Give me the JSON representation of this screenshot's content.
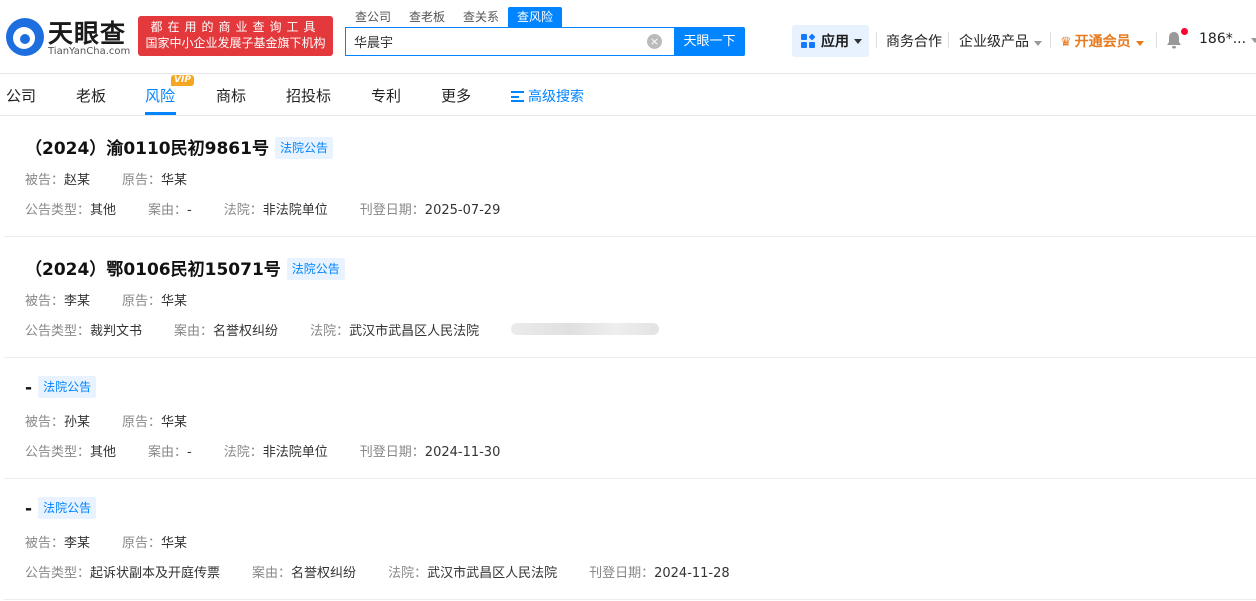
{
  "header": {
    "logo_cn": "天眼查",
    "logo_en": "TianYanCha.com",
    "slogan_line1": "都在用的商业查询工具",
    "slogan_line2": "国家中小企业发展子基金旗下机构",
    "search_tabs": [
      "查公司",
      "查老板",
      "查关系",
      "查风险"
    ],
    "active_search_tab": "查风险",
    "search_value": "华晨宇",
    "search_button": "天眼一下",
    "apps_label": "应用",
    "business_coop": "商务合作",
    "enterprise_products": "企业级产品",
    "vip_link": "开通会员",
    "user_phone": "186*..."
  },
  "subnav": {
    "items": [
      "公司",
      "老板",
      "风险",
      "商标",
      "招投标",
      "专利",
      "更多"
    ],
    "active": "风险",
    "vip_badge": "VIP",
    "advanced_search": "高级搜索"
  },
  "labels": {
    "defendant": "被告：",
    "plaintiff": "原告：",
    "notice_type": "公告类型：",
    "cause": "案由：",
    "court": "法院：",
    "publish_date": "刊登日期："
  },
  "records": [
    {
      "title": "（2024）渝0110民初9861号",
      "tag": "法院公告",
      "defendant": "赵某",
      "plaintiff": "华某",
      "notice_type": "其他",
      "cause": "-",
      "court": "非法院单位",
      "publish_date": "2025-07-29"
    },
    {
      "title": "（2024）鄂0106民初15071号",
      "tag": "法院公告",
      "defendant": "李某",
      "plaintiff": "华某",
      "notice_type": "裁判文书",
      "cause": "名誉权纠纷",
      "court": "武汉市武昌区人民法院",
      "publish_date": ""
    },
    {
      "title": "-",
      "tag": "法院公告",
      "defendant": "孙某",
      "plaintiff": "华某",
      "notice_type": "其他",
      "cause": "-",
      "court": "非法院单位",
      "publish_date": "2024-11-30"
    },
    {
      "title": "-",
      "tag": "法院公告",
      "defendant": "李某",
      "plaintiff": "华某",
      "notice_type": "起诉状副本及开庭传票",
      "cause": "名誉权纠纷",
      "court": "武汉市武昌区人民法院",
      "publish_date": "2024-11-28"
    }
  ]
}
